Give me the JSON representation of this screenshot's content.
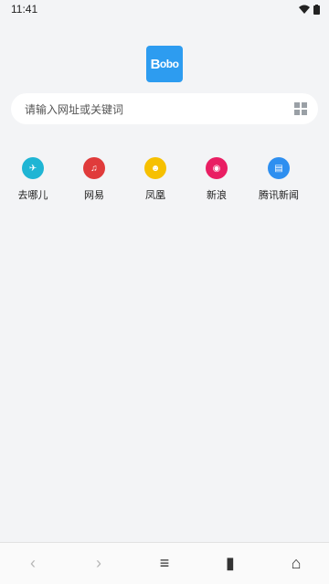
{
  "status_bar": {
    "time": "11:41"
  },
  "logo": {
    "text_big": "B",
    "text_small": "obo"
  },
  "search": {
    "placeholder": "请输入网址或关键词"
  },
  "shortcuts": [
    {
      "label": "去哪儿",
      "color": "#1fb5d4",
      "icon": "plane-icon",
      "glyph": "✈"
    },
    {
      "label": "网易",
      "color": "#e03b3b",
      "icon": "music-note-icon",
      "glyph": "♫"
    },
    {
      "label": "凤凰",
      "color": "#f6c000",
      "icon": "phoenix-icon",
      "glyph": "☻"
    },
    {
      "label": "新浪",
      "color": "#e91e63",
      "icon": "rss-icon",
      "glyph": "◉"
    },
    {
      "label": "腾讯新闻",
      "color": "#2e8ff0",
      "icon": "news-icon",
      "glyph": "▤"
    }
  ],
  "bottom_nav": {
    "back": "‹",
    "forward": "›",
    "menu": "≡",
    "bookmarks": "▮",
    "home": "⌂"
  }
}
